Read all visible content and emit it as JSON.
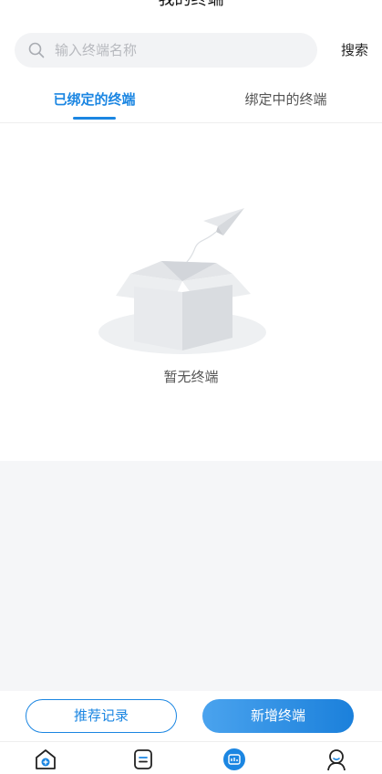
{
  "header": {
    "title": "我的终端"
  },
  "search": {
    "placeholder": "输入终端名称",
    "button_label": "搜索"
  },
  "tabs": [
    {
      "label": "已绑定的终端",
      "active": true
    },
    {
      "label": "绑定中的终端",
      "active": false
    }
  ],
  "empty_state": {
    "icon": "empty-box-with-paper-plane",
    "text": "暂无终端"
  },
  "actions": {
    "record_label": "推荐记录",
    "add_label": "新增终端"
  },
  "bottom_nav": [
    {
      "icon": "home-plus-icon",
      "active": false
    },
    {
      "icon": "list-doc-icon",
      "active": false
    },
    {
      "icon": "terminal-chart-icon",
      "active": true
    },
    {
      "icon": "profile-icon",
      "active": false
    }
  ],
  "colors": {
    "accent": "#1b86e2",
    "background": "#f5f6f8"
  }
}
